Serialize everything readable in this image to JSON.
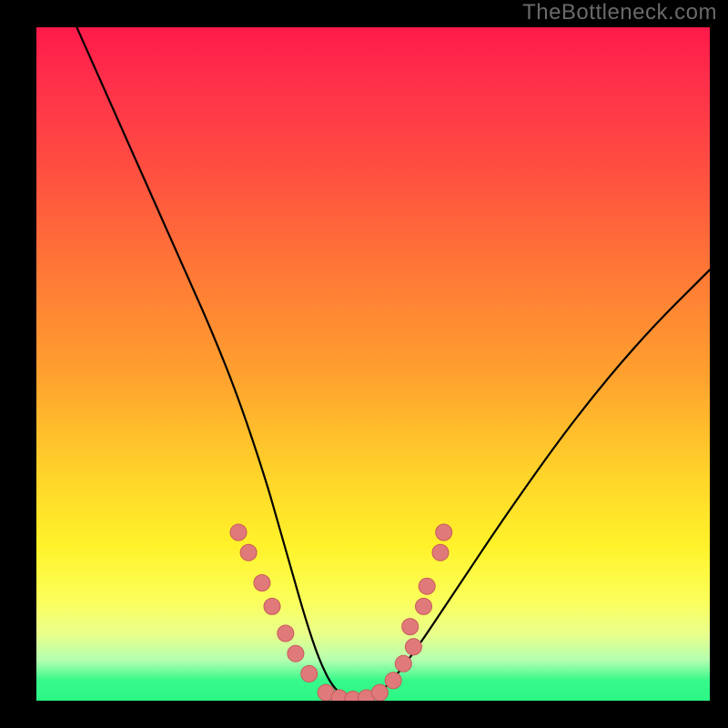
{
  "watermark": "TheBottleneck.com",
  "chart_data": {
    "type": "line",
    "title": "",
    "xlabel": "",
    "ylabel": "",
    "xlim": [
      0,
      100
    ],
    "ylim": [
      0,
      100
    ],
    "grid": false,
    "legend": false,
    "annotations": [],
    "series": [
      {
        "name": "bottleneck-curve",
        "color": "#000000",
        "x": [
          6,
          10,
          14,
          18,
          22,
          26,
          30,
          34,
          36,
          38,
          40,
          42,
          44,
          46,
          48,
          50,
          52,
          56,
          62,
          70,
          80,
          90,
          100
        ],
        "y": [
          100,
          91,
          82,
          73,
          64,
          55,
          45,
          33,
          26,
          19,
          12,
          6,
          2,
          0.5,
          0,
          0.5,
          2,
          7,
          16,
          28,
          42,
          54,
          64
        ]
      }
    ],
    "markers": [
      {
        "name": "marker-left-1",
        "x": 30.0,
        "y": 25.0
      },
      {
        "name": "marker-left-2",
        "x": 31.5,
        "y": 22.0
      },
      {
        "name": "marker-left-3",
        "x": 33.5,
        "y": 17.5
      },
      {
        "name": "marker-left-4",
        "x": 35.0,
        "y": 14.0
      },
      {
        "name": "marker-left-5",
        "x": 37.0,
        "y": 10.0
      },
      {
        "name": "marker-left-6",
        "x": 38.5,
        "y": 7.0
      },
      {
        "name": "marker-left-7",
        "x": 40.5,
        "y": 4.0
      },
      {
        "name": "marker-min-1",
        "x": 43.0,
        "y": 1.2
      },
      {
        "name": "marker-min-2",
        "x": 45.0,
        "y": 0.4
      },
      {
        "name": "marker-min-3",
        "x": 47.0,
        "y": 0.2
      },
      {
        "name": "marker-min-4",
        "x": 49.0,
        "y": 0.4
      },
      {
        "name": "marker-min-5",
        "x": 51.0,
        "y": 1.2
      },
      {
        "name": "marker-right-1",
        "x": 53.0,
        "y": 3.0
      },
      {
        "name": "marker-right-2",
        "x": 54.5,
        "y": 5.5
      },
      {
        "name": "marker-right-3",
        "x": 56.0,
        "y": 8.0
      },
      {
        "name": "marker-right-4",
        "x": 55.5,
        "y": 11.0
      },
      {
        "name": "marker-right-5",
        "x": 57.5,
        "y": 14.0
      },
      {
        "name": "marker-right-6",
        "x": 58.0,
        "y": 17.0
      },
      {
        "name": "marker-right-7",
        "x": 60.0,
        "y": 22.0
      },
      {
        "name": "marker-right-8",
        "x": 60.5,
        "y": 25.0
      }
    ],
    "marker_style": {
      "fill": "#e07a7a",
      "stroke": "#c85a5a",
      "radius_px": 9
    },
    "gradient_stops": [
      {
        "pos": 0.0,
        "color": "#ff1a4a"
      },
      {
        "pos": 0.4,
        "color": "#ff8a30"
      },
      {
        "pos": 0.75,
        "color": "#fff22a"
      },
      {
        "pos": 0.97,
        "color": "#37f98a"
      },
      {
        "pos": 1.0,
        "color": "#2df884"
      }
    ]
  }
}
